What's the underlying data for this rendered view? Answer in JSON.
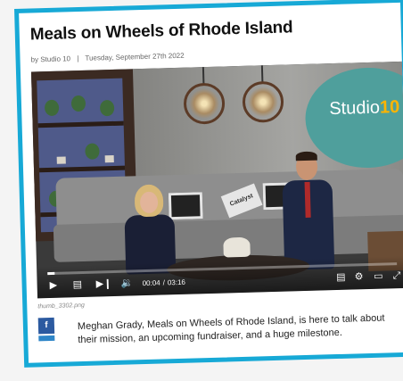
{
  "article": {
    "title": "Meals on Wheels of Rhode Island",
    "byline": {
      "author": "by Studio 10",
      "separator": "|",
      "date": "Tuesday, September 27th 2022"
    },
    "video": {
      "brand_text": "Studio",
      "brand_number": "10",
      "pillow_text": "Catalyst",
      "time_current": "00:04",
      "time_separator": "/",
      "time_total": "03:16",
      "progress_fraction": 0.02
    },
    "image_caption": "thumb_3302.png",
    "share": {
      "facebook_label": "f"
    },
    "body": "Meghan Grady, Meals on Wheels of Rhode Island, is here to talk about their mission, an upcoming fundraiser, and a huge milestone."
  },
  "colors": {
    "frame": "#17a9d6",
    "facebook": "#2c5aa0",
    "studio_accent": "#ffb400"
  }
}
